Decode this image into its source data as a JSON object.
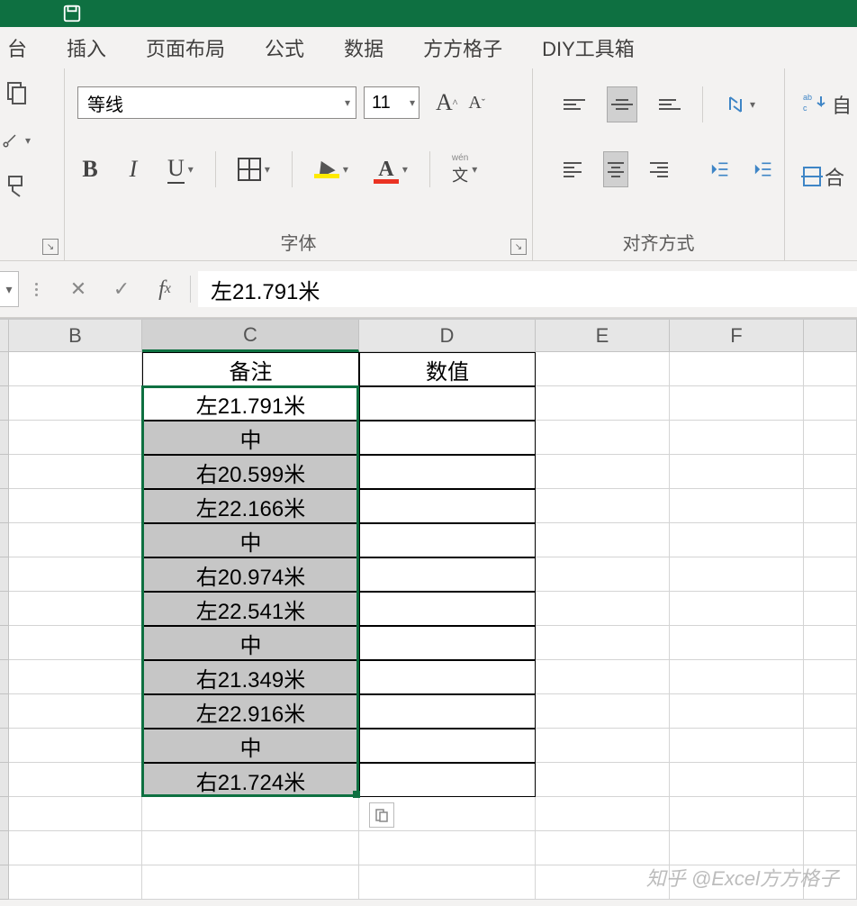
{
  "tabs": [
    "插入",
    "页面布局",
    "公式",
    "数据",
    "方方格子",
    "DIY工具箱"
  ],
  "tab0_partial": "台",
  "font": {
    "name": "等线",
    "size": "11",
    "group_label": "字体"
  },
  "align": {
    "group_label": "对齐方式"
  },
  "last_group": {
    "wraptext_label": "自",
    "merge_label": "合"
  },
  "formula_bar": {
    "value": "左21.791米"
  },
  "columns": [
    "B",
    "C",
    "D",
    "E",
    "F"
  ],
  "table": {
    "header_c": "备注",
    "header_d": "数值",
    "rows": [
      "左21.791米",
      "中",
      "右20.599米",
      "左22.166米",
      "中",
      "右20.974米",
      "左22.541米",
      "中",
      "右21.349米",
      "左22.916米",
      "中",
      "右21.724米"
    ]
  },
  "watermark": "知乎 @Excel方方格子"
}
